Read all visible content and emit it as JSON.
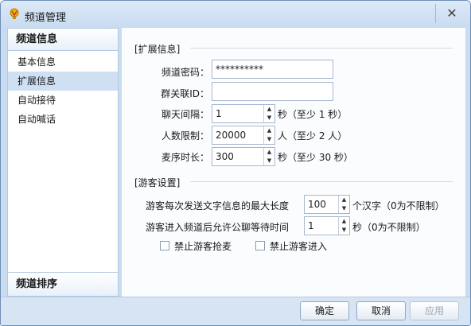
{
  "window": {
    "title": "频道管理",
    "close_glyph": "✕"
  },
  "sidebar": {
    "header_top": "频道信息",
    "items": [
      {
        "label": "基本信息",
        "active": false
      },
      {
        "label": "扩展信息",
        "active": true
      },
      {
        "label": "自动接待",
        "active": false
      },
      {
        "label": "自动喊话",
        "active": false
      }
    ],
    "header_bottom": "频道排序"
  },
  "ext_section": {
    "title": "[扩展信息]",
    "password_label": "频道密码：",
    "password_value": "**********",
    "group_id_label": "群关联ID：",
    "group_id_value": "",
    "chat_interval_label": "聊天间隔：",
    "chat_interval_value": "1",
    "chat_interval_suffix": "秒（至少 1 秒）",
    "user_limit_label": "人数限制：",
    "user_limit_value": "20000",
    "user_limit_suffix": "人（至少 2 人）",
    "mic_time_label": "麦序时长：",
    "mic_time_value": "300",
    "mic_time_suffix": "秒（至少 30 秒）"
  },
  "guest_section": {
    "title": "[游客设置]",
    "max_text_label": "游客每次发送文字信息的最大长度",
    "max_text_value": "100",
    "max_text_suffix": "个汉字（0为不限制）",
    "wait_time_label": "游客进入频道后允许公聊等待时间",
    "wait_time_value": "1",
    "wait_time_suffix": "秒（0为不限制）",
    "no_grab_mic_label": "禁止游客抢麦",
    "no_grab_mic_checked": false,
    "no_enter_label": "禁止游客进入",
    "no_enter_checked": false
  },
  "footer": {
    "ok_label": "确定",
    "cancel_label": "取消",
    "apply_label": "应用"
  },
  "icons": {
    "app": "lightbulb-icon",
    "spin_up": "▲",
    "spin_down": "▼"
  },
  "colors": {
    "window_bg": "#c9dcf0",
    "active_nav": "#cfe0f3",
    "border": "#6f8fb6"
  }
}
